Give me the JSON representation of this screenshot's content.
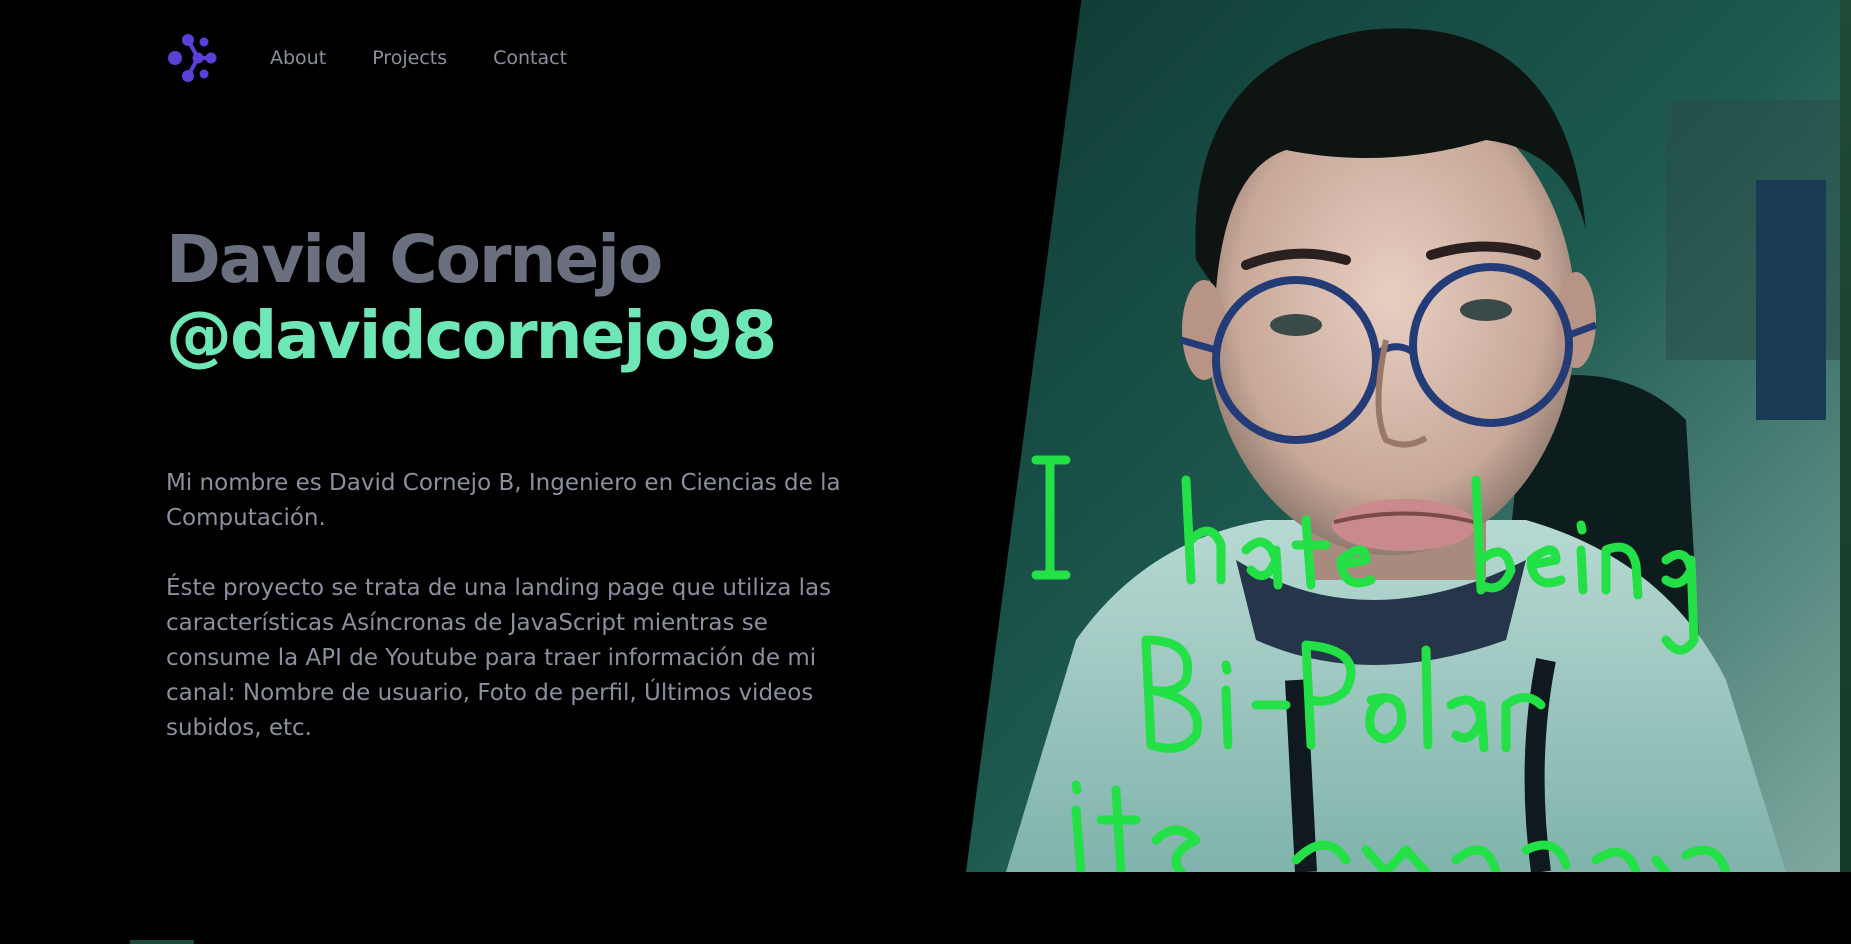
{
  "nav": {
    "logo_icon": "nodes-logo-icon",
    "links": [
      {
        "label": "About"
      },
      {
        "label": "Projects"
      },
      {
        "label": "Contact"
      }
    ]
  },
  "hero": {
    "name": "David Cornejo",
    "handle": "@davidcornejo98"
  },
  "description": {
    "paragraph1": "Mi nombre es David Cornejo B, Ingeniero en Ciencias de la Computación.",
    "paragraph2": "Éste proyecto se trata de una landing page que utiliza las características Asíncronas de JavaScript mientras se consume la API de Youtube para traer información de mi canal: Nombre de usuario, Foto de perfil, Últimos videos subidos, etc."
  },
  "photo": {
    "overlay_line1": "I hate being",
    "overlay_line2": "Bi-Polar",
    "overlay_line3": "its awesome"
  },
  "colors": {
    "background": "#000000",
    "accent_green": "#6ee7b7",
    "name_gray": "#6b7080",
    "text_gray": "#8b8f9e",
    "logo_purple": "#5b3fd8",
    "scribble_green": "#22e045"
  }
}
